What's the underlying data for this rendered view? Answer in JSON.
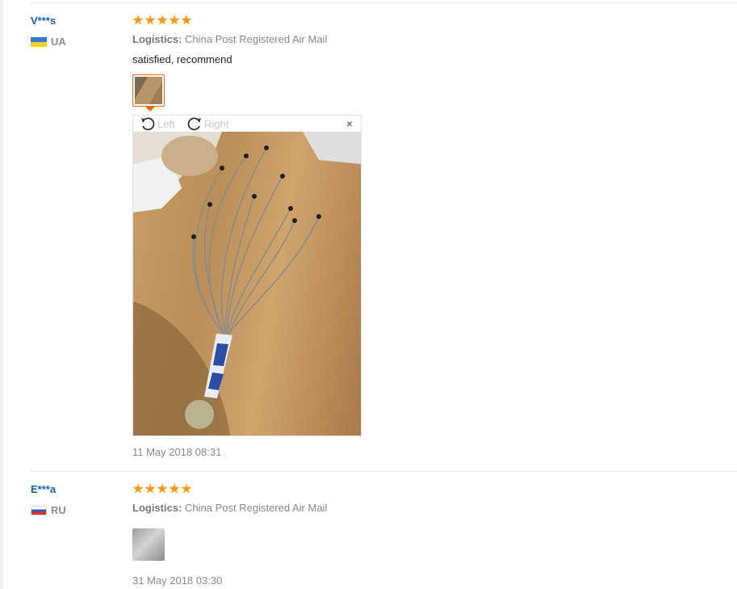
{
  "reviews": [
    {
      "user": "V***s",
      "country": "UA",
      "stars": 5,
      "logistics_label": "Logistics:",
      "logistics_value": "China Post Registered Air Mail",
      "comment": "satisfied, recommend",
      "date": "11 May 2018 08:31",
      "viewer": {
        "rotate_left": "Left",
        "rotate_right": "Right",
        "close": "×"
      }
    },
    {
      "user": "E***a",
      "country": "RU",
      "stars": 5,
      "logistics_label": "Logistics:",
      "logistics_value": "China Post Registered Air Mail",
      "date": "31 May 2018 03:30"
    }
  ],
  "colors": {
    "star": "#f39b13",
    "user_name": "#1a5ea8",
    "accent": "#e86b0c"
  }
}
